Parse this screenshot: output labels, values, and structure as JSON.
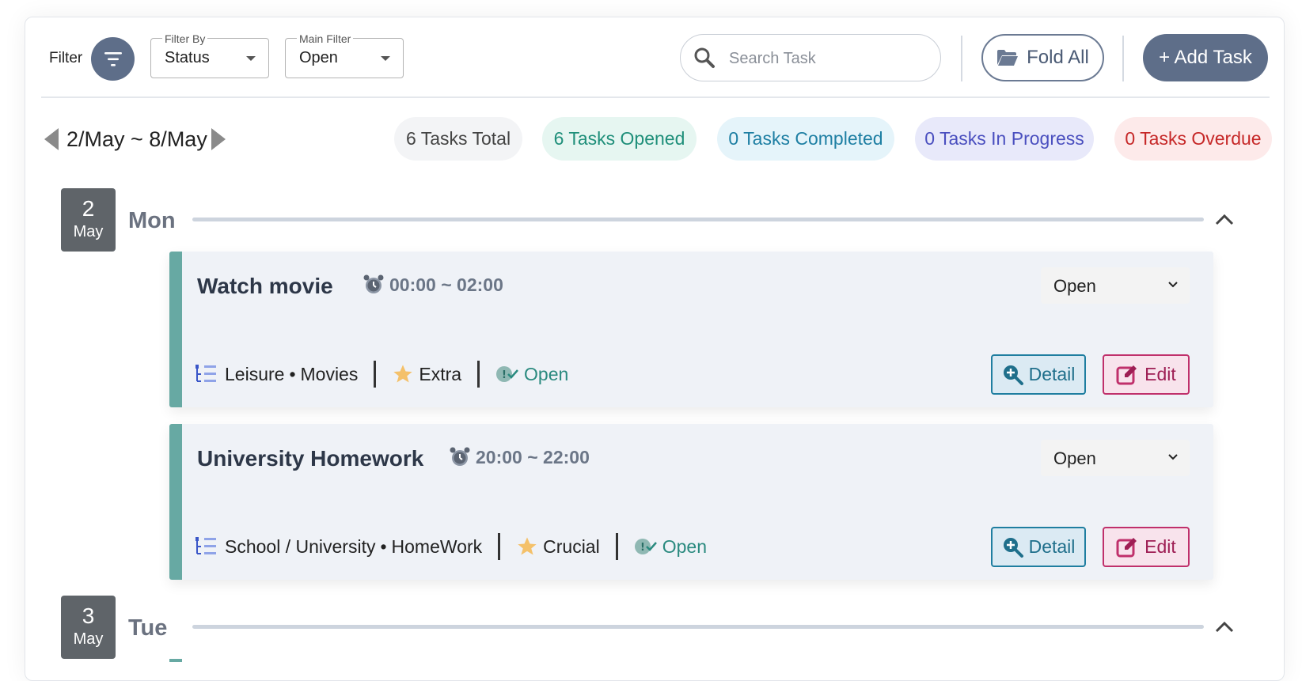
{
  "toolbar": {
    "filter_label": "Filter",
    "filter_by": {
      "legend": "Filter By",
      "value": "Status"
    },
    "main_filter": {
      "legend": "Main Filter",
      "value": "Open"
    },
    "search_placeholder": "Search Task",
    "fold_all": "Fold All",
    "add_task": "+ Add Task"
  },
  "week": {
    "label": "2/May ~ 8/May"
  },
  "summary": {
    "total": "6 Tasks Total",
    "opened": "6 Tasks Opened",
    "completed": "0 Tasks Completed",
    "in_progress": "0 Tasks In Progress",
    "overdue": "0 Tasks Overdue"
  },
  "colors": {
    "accent": "#5e6e89",
    "card_border": "#67a9a3",
    "opened": "#1f8f7a",
    "completed": "#1e7fa3",
    "in_progress": "#4a4fbf",
    "overdue": "#c62828"
  },
  "days": [
    {
      "day": "2",
      "month": "May",
      "name": "Mon",
      "tasks": [
        {
          "title": "Watch movie",
          "time": "00:00 ~ 02:00",
          "status": "Open",
          "category": "Leisure",
          "subcategory": "Movies",
          "priority": "Extra",
          "state": "Open",
          "detail": "Detail",
          "edit": "Edit"
        },
        {
          "title": "University Homework",
          "time": "20:00 ~ 22:00",
          "status": "Open",
          "category": "School / University",
          "subcategory": "HomeWork",
          "priority": "Crucial",
          "state": "Open",
          "detail": "Detail",
          "edit": "Edit"
        }
      ]
    },
    {
      "day": "3",
      "month": "May",
      "name": "Tue",
      "tasks": []
    }
  ],
  "icons": {
    "filter": "filter-lines-icon",
    "search": "magnifier-icon",
    "fold": "folder-open-icon",
    "alarm": "alarm-clock-icon",
    "category": "list-tree-icon",
    "priority": "star-icon",
    "state": "status-check-icon",
    "detail": "zoom-plus-icon",
    "edit": "pencil-square-icon"
  }
}
